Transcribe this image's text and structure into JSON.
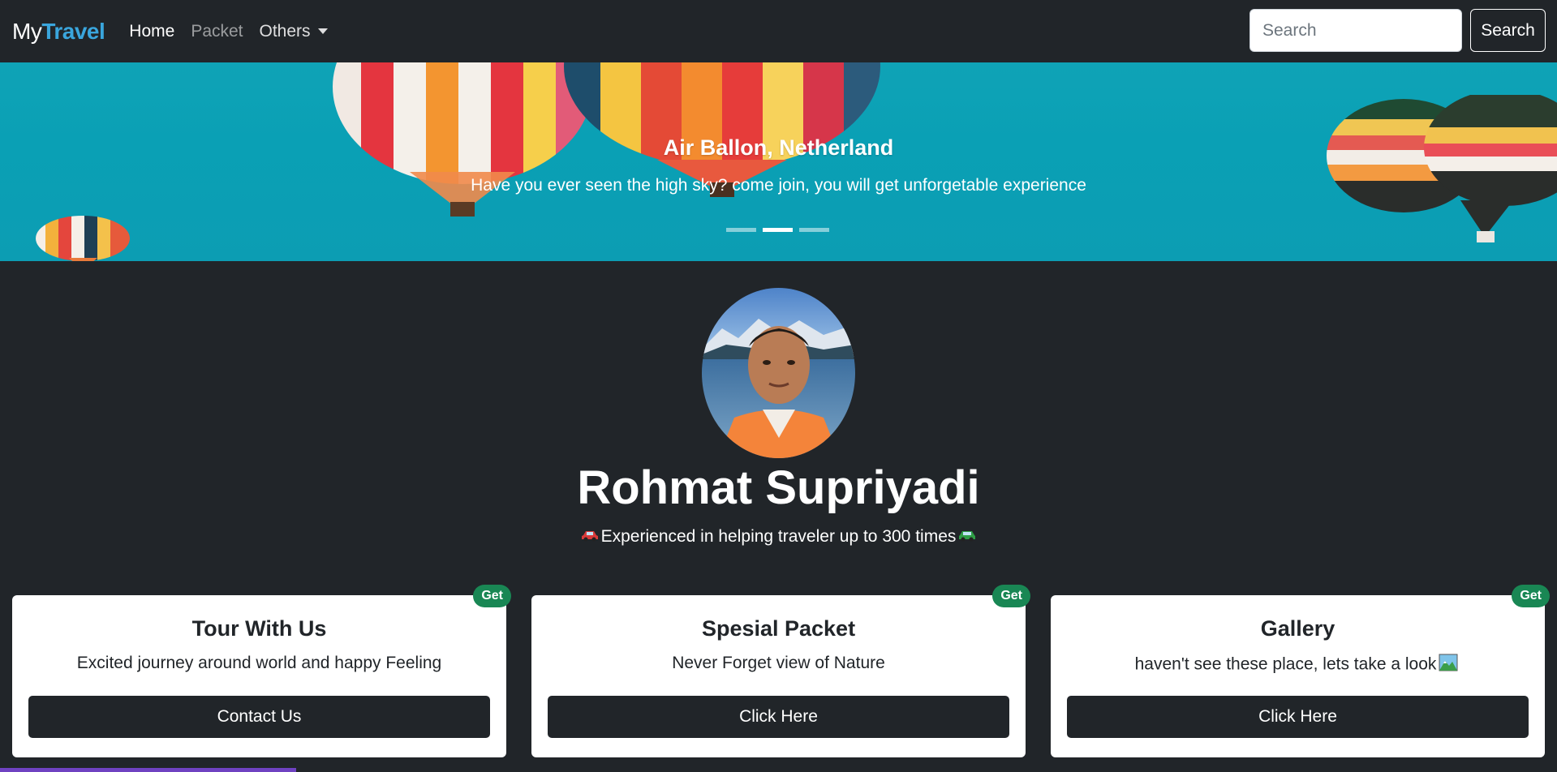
{
  "navbar": {
    "brand_prefix": "My",
    "brand_accent": "Travel",
    "links": [
      "Home",
      "Packet",
      "Others"
    ],
    "search_placeholder": "Search",
    "search_button": "Search"
  },
  "hero": {
    "title": "Air Ballon, Netherland",
    "subtitle": "Have you ever seen the high sky? come join, you will get unforgetable experience",
    "slides_count": 3,
    "active_slide": 2
  },
  "profile": {
    "name": "Rohmat Supriyadi",
    "description": "Experienced in helping traveler up to 300 times"
  },
  "cards": [
    {
      "title": "Tour With Us",
      "text": "Excited journey around world and happy Feeling",
      "button": "Contact Us",
      "badge": "Get"
    },
    {
      "title": "Spesial Packet",
      "text": "Never Forget view of Nature",
      "button": "Click Here",
      "badge": "Get"
    },
    {
      "title": "Gallery",
      "text": "haven't see these place, lets take a look",
      "button": "Click Here",
      "badge": "Get"
    }
  ],
  "colors": {
    "background": "#212529",
    "brand_accent": "#3aa6dd",
    "hero_sky": "#0fa3b6",
    "badge": "#198754",
    "bottom_strip": "#6f42c1"
  }
}
